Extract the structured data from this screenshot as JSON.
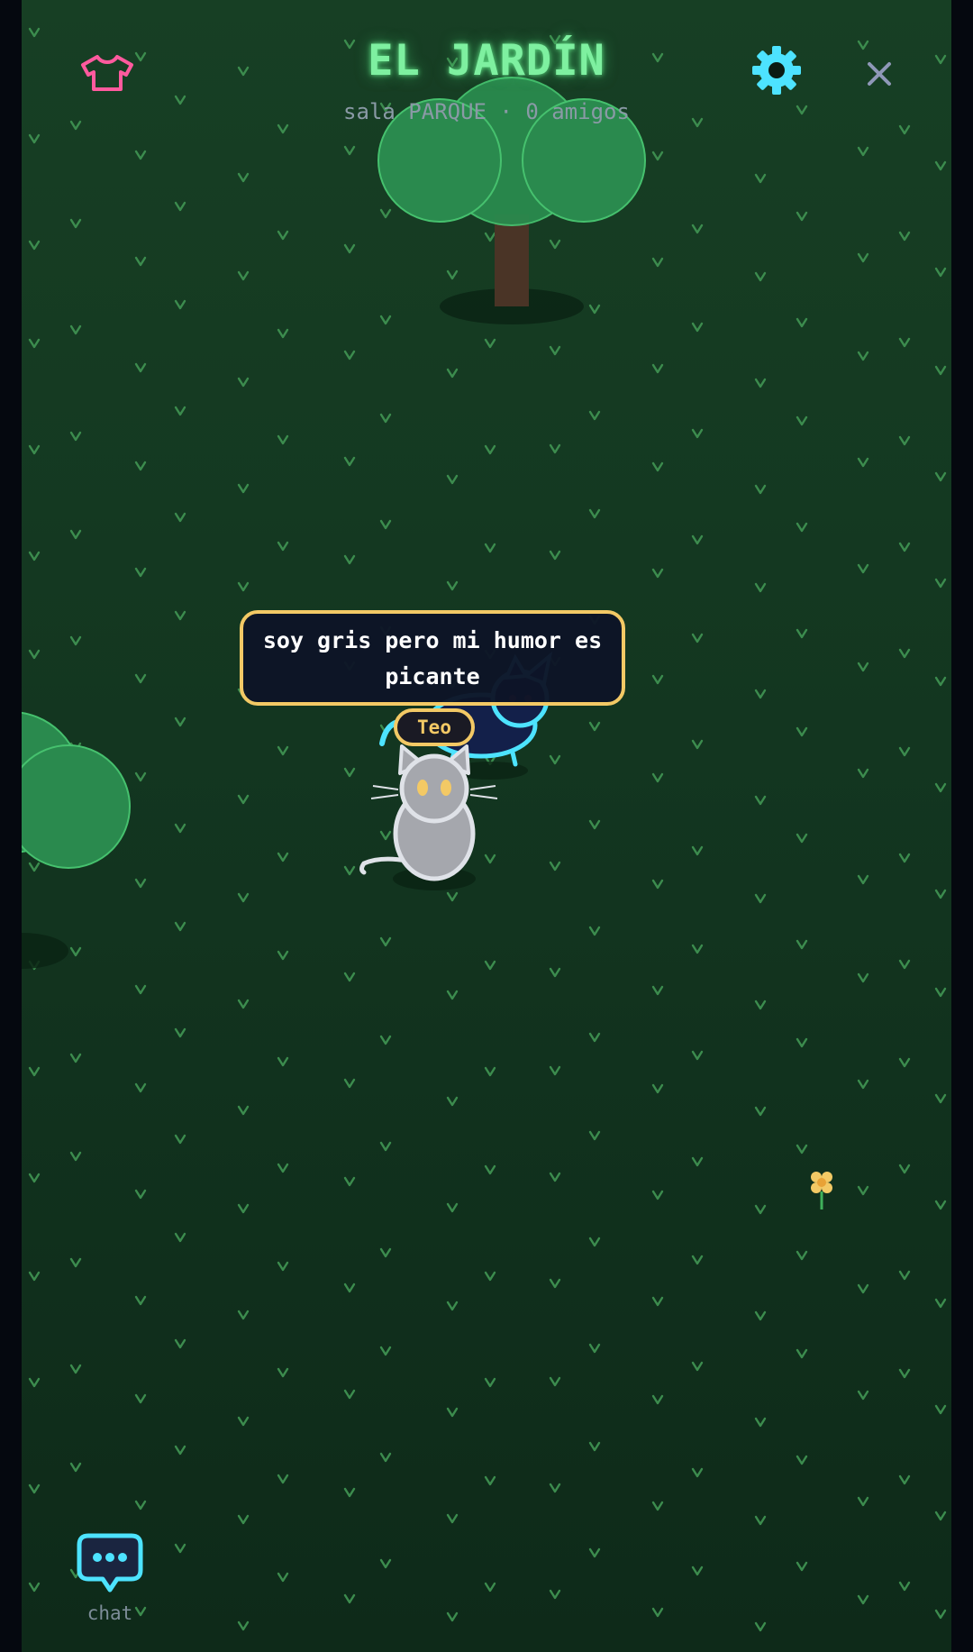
{
  "header": {
    "title": "EL JARDÍN",
    "subtitle": "sala PARQUE · 0 amigos"
  },
  "toolbar": {
    "wardrobe_icon": "tshirt-icon",
    "settings_icon": "gear-icon",
    "close_icon": "close-icon"
  },
  "player": {
    "name": "Teo",
    "speech": "soy gris pero mi humor es picante"
  },
  "chat": {
    "icon": "chat-bubble-icon",
    "label": "chat"
  },
  "colors": {
    "title": "#7ef0a0",
    "accent_pink": "#ff5a9e",
    "accent_cyan": "#4de3ff",
    "bubble_border": "#f3c965",
    "grass": "#173f24"
  }
}
